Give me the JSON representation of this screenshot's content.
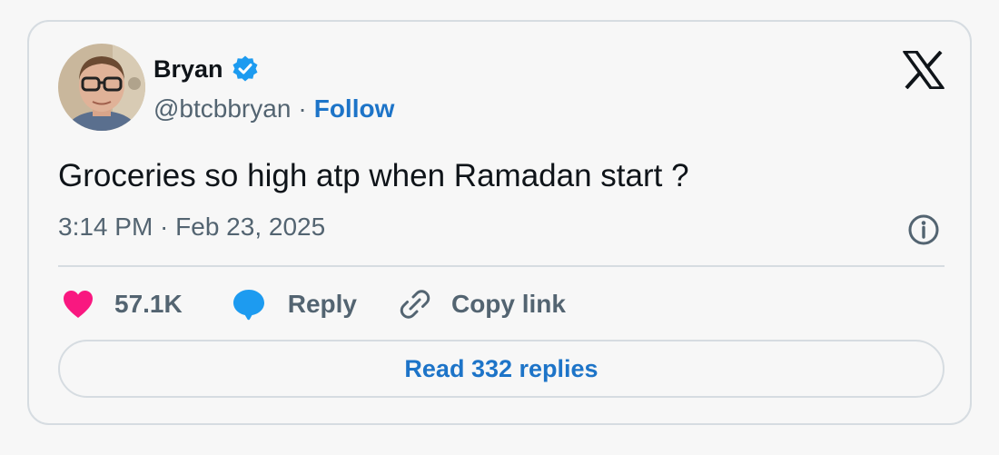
{
  "author": {
    "name": "Bryan",
    "handle": "@btcbbryan",
    "separator": "·",
    "follow_label": "Follow",
    "verified": true
  },
  "icons": {
    "verified": "verified-badge-icon",
    "platform_logo": "x-logo-icon",
    "info": "info-icon",
    "like": "heart-icon",
    "reply": "reply-bubble-icon",
    "copy": "link-icon"
  },
  "tweet": {
    "text": "Groceries so high atp when Ramadan start ?",
    "timestamp": "3:14 PM · Feb 23, 2025"
  },
  "actions": {
    "like_count": "57.1K",
    "reply_label": "Reply",
    "copy_link_label": "Copy link"
  },
  "read_replies_label": "Read 332 replies",
  "colors": {
    "accent": "#1d74c8",
    "verified": "#1d9bf0",
    "like": "#f91880",
    "muted": "#536471",
    "text": "#0f1419",
    "border": "#d6dce1"
  }
}
